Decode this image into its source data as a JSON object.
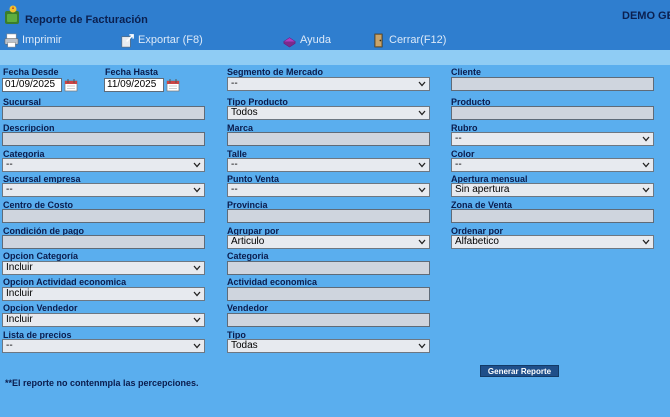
{
  "app": {
    "title": "Reporte de Facturación",
    "company": "DEMO GE"
  },
  "toolbar": {
    "print": "Imprimir",
    "export": "Exportar (F8)",
    "help": "Ayuda",
    "close": "Cerrar(F12)"
  },
  "form": {
    "fecha_desde": {
      "label": "Fecha Desde",
      "value": "01/09/2025"
    },
    "fecha_hasta": {
      "label": "Fecha Hasta",
      "value": "11/09/2025"
    },
    "segmento": {
      "label": "Segmento de Mercado",
      "value": "--"
    },
    "cliente": {
      "label": "Cliente",
      "value": ""
    },
    "sucursal": {
      "label": "Sucursal",
      "value": ""
    },
    "tipo_producto": {
      "label": "Tipo Producto",
      "value": "Todos"
    },
    "producto": {
      "label": "Producto",
      "value": ""
    },
    "descripcion": {
      "label": "Descripcion",
      "value": ""
    },
    "marca": {
      "label": "Marca",
      "value": ""
    },
    "rubro": {
      "label": "Rubro",
      "value": "--"
    },
    "categoria": {
      "label": "Categoria",
      "value": "--"
    },
    "talle": {
      "label": "Talle",
      "value": "--"
    },
    "color": {
      "label": "Color",
      "value": "--"
    },
    "sucursal_empresa": {
      "label": "Sucursal empresa",
      "value": "--"
    },
    "punto_venta": {
      "label": "Punto Venta",
      "value": "--"
    },
    "apertura_mensual": {
      "label": "Apertura mensual",
      "value": "Sin apertura"
    },
    "centro_costo": {
      "label": "Centro de Costo",
      "value": ""
    },
    "provincia": {
      "label": "Provincia",
      "value": ""
    },
    "zona_venta": {
      "label": "Zona de Venta",
      "value": ""
    },
    "condicion_pago": {
      "label": "Condición de pago",
      "value": ""
    },
    "agrupar_por": {
      "label": "Agrupar por",
      "value": "Articulo"
    },
    "ordenar_por": {
      "label": "Ordenar por",
      "value": "Alfabetico"
    },
    "opcion_categoria": {
      "label": "Opcion Categoría",
      "value": "Incluir"
    },
    "categoria_texto": {
      "label": "Categoria",
      "value": ""
    },
    "opcion_actividad": {
      "label": "Opcion Actividad economica",
      "value": "Incluir"
    },
    "actividad_economica": {
      "label": "Actividad economica",
      "value": ""
    },
    "opcion_vendedor": {
      "label": "Opcion Vendedor",
      "value": "Incluir"
    },
    "vendedor": {
      "label": "Vendedor",
      "value": ""
    },
    "lista_precios": {
      "label": "Lista de precios",
      "value": "--"
    },
    "tipo": {
      "label": "Tipo",
      "value": "Todas"
    }
  },
  "generate_button": "Generar Reporte",
  "note": "**El reporte no contenmpla las percepciones."
}
